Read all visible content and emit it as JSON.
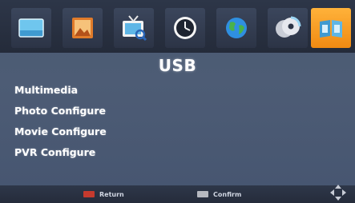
{
  "screen": {
    "title": "USB",
    "tabs": [
      {
        "name": "picture-icon",
        "active": false
      },
      {
        "name": "photo-icon",
        "active": false
      },
      {
        "name": "tv-search-icon",
        "active": false
      },
      {
        "name": "clock-icon",
        "active": false
      },
      {
        "name": "globe-icon",
        "active": false
      },
      {
        "name": "disc-icon",
        "active": false
      },
      {
        "name": "usb-book-icon",
        "active": true
      }
    ],
    "menu": [
      {
        "label": "Multimedia"
      },
      {
        "label": "Photo Configure"
      },
      {
        "label": "Movie Configure"
      },
      {
        "label": "PVR Configure"
      }
    ],
    "hints": {
      "return_label": "Return",
      "confirm_label": "Confirm"
    },
    "colors": {
      "background": "#4a5a72",
      "active_tab": "#f59a1e",
      "text": "#ffffff"
    }
  }
}
